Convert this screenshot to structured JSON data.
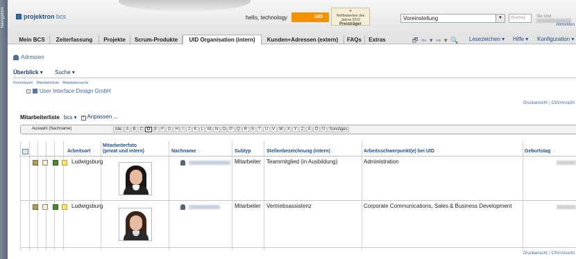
{
  "window": {
    "side_label": "Navigation"
  },
  "header": {
    "logo_name": "projektron",
    "logo_product": "bcs",
    "greeting": "hello, technology",
    "uid_badge": "UID",
    "award_line1": "Wettbewerber des Jahres 2010",
    "award_line2": "Preisträger",
    "preset_value": "Voreinstellung",
    "search_placeholder": "[Suche]",
    "sind_label": "Sie sind",
    "abmelden": "Abmelden"
  },
  "tabs": [
    {
      "label": "Mein BCS"
    },
    {
      "label": "Zeiterfassung"
    },
    {
      "label": "Projekte"
    },
    {
      "label": "Scrum-Produkte"
    },
    {
      "label": "UID Organisation (intern)"
    },
    {
      "label": "Kunden+Adressen (extern)"
    },
    {
      "label": "FAQs"
    },
    {
      "label": "Extras"
    }
  ],
  "toolbar": {
    "icons": "🗗 ⇦ ▾ ⇨ ▾ 🔍",
    "lesezeichen": "Lesezeichen ▾",
    "hilfe": "Hilfe ▾",
    "konfiguration": "Konfiguration ▾"
  },
  "content": {
    "adressen": "Adressen",
    "ueberblick": "Überblick ▾",
    "suche": "Suche ▾",
    "subnav": [
      "Firmenbaum",
      "Mitarbeiterliste",
      "Mitarbeitersuche"
    ],
    "tree_minus": "−",
    "company": "User Interface Design GmbH",
    "druckansicht": "Druckansicht",
    "csv": "CSV/Ansicht",
    "list_title": "Mitarbeiterliste",
    "list_filter": "bcs ▾",
    "list_plus": "+",
    "anpassen": "Anpassen ..."
  },
  "alphabet": {
    "label": "Auswahl (Nachname)",
    "letters": [
      "Alle",
      "A",
      "B",
      "C",
      "D",
      "E",
      "F",
      "G",
      "H",
      "I",
      "J",
      "K",
      "L",
      "M",
      "N",
      "O",
      "P",
      "Q",
      "R",
      "S",
      "T",
      "U",
      "V",
      "W",
      "X",
      "Y",
      "Z",
      "Ä",
      "Ö",
      "Ü",
      "Sonstiges"
    ],
    "active": "D"
  },
  "table": {
    "headers": {
      "arbeitsort": "Arbeitsort",
      "foto_l1": "Mitarbeiterfoto",
      "foto_l2": "(privat und intern)",
      "nachname": "Nachname",
      "subtyp": "Subtyp",
      "stelle": "Stellenbezeichnung (intern)",
      "schwerpunkt": "Arbeitsschwerpunkt(e) bei UID",
      "geburtstag": "Geburtstag"
    },
    "rows": [
      {
        "arbeitsort": "Ludwigsburg",
        "subtyp": "Mitarbeiter",
        "stelle": "Teammitglied (in Ausbildung)",
        "schwerpunkt": "Administration"
      },
      {
        "arbeitsort": "Ludwigsburg",
        "subtyp": "Mitarbeiter",
        "stelle": "Vertriebsassistenz",
        "schwerpunkt": "Corporate Communications, Sales & Business Development"
      }
    ]
  },
  "colors": {
    "accent": "#1f4f8b",
    "badge": "#f29200"
  }
}
